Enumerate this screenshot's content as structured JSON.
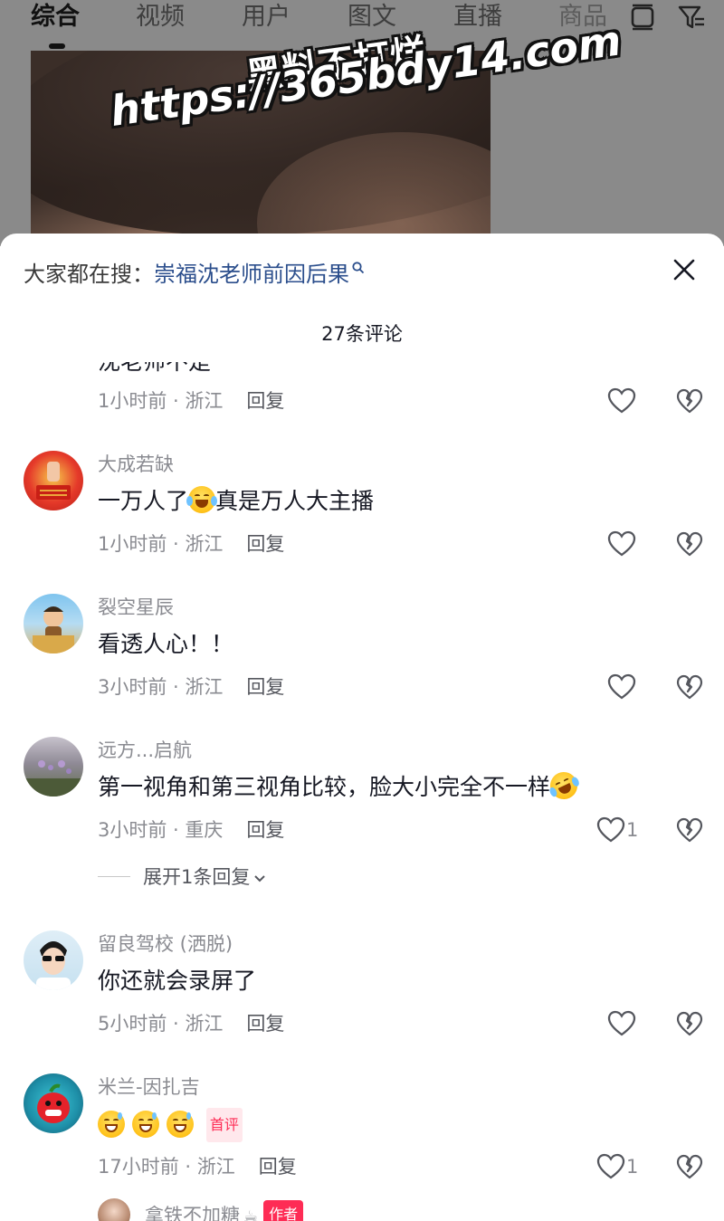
{
  "tabs": [
    {
      "label": "综合",
      "active": true
    },
    {
      "label": "视频",
      "active": false
    },
    {
      "label": "用户",
      "active": false
    },
    {
      "label": "图文",
      "active": false
    },
    {
      "label": "直播",
      "active": false
    },
    {
      "label": "商品",
      "active": false
    }
  ],
  "watermark": {
    "line1": "黑料不打烊",
    "line2": "https://365bdy14.com"
  },
  "search_hint": {
    "label": "大家都在搜：",
    "query": "崇福沈老师前因后果"
  },
  "comment_count": "27条评论",
  "partial_comment": {
    "text": "沈老师不是",
    "time": "1小时前 · 浙江",
    "reply_label": "回复"
  },
  "comments": [
    {
      "name": "大成若缺",
      "text_before": "一万人了",
      "emoji": "crying-laughing",
      "text_after": "真是万人大主播",
      "time": "1小时前 · 浙江",
      "reply_label": "回复",
      "likes": ""
    },
    {
      "name": "裂空星辰",
      "text_before": "看透人心！！",
      "emoji": "",
      "text_after": "",
      "time": "3小时前 · 浙江",
      "reply_label": "回复",
      "likes": ""
    },
    {
      "name": "远方...启航",
      "text_before": "第一视角和第三视角比较，脸大小完全不一样",
      "emoji": "rolling-laughing",
      "text_after": "",
      "time": "3小时前 · 重庆",
      "reply_label": "回复",
      "likes": "1"
    },
    {
      "name": "留良驾校 (洒脱)",
      "text_before": "你还就会录屏了",
      "emoji": "",
      "text_after": "",
      "time": "5小时前 · 浙江",
      "reply_label": "回复",
      "likes": ""
    },
    {
      "name": "米兰-因扎吉",
      "text_before": "",
      "emoji": "grin-sweat-x3",
      "text_after": "",
      "tag": "首评",
      "time": "17小时前 · 浙江",
      "reply_label": "回复",
      "likes": "1"
    }
  ],
  "expand_replies": "展开1条回复",
  "last_comment": {
    "name": "拿铁不加糖",
    "tag": "作者"
  },
  "colors": {
    "link": "#2b4e8c",
    "accent": "#fe2c55",
    "meta": "#8a8b91"
  }
}
